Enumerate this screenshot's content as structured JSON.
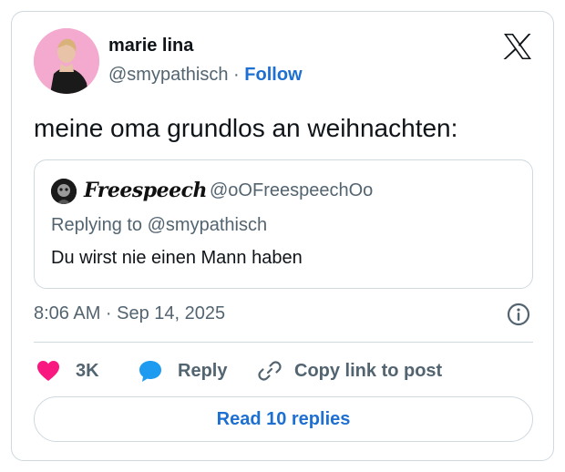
{
  "author": {
    "name": "marie lina",
    "handle": "@smypathisch",
    "separator": "·",
    "follow_label": "Follow"
  },
  "tweet": {
    "text": "meine oma grundlos an weihnachten:",
    "timestamp": "8:06 AM · Sep 14, 2025"
  },
  "quoted": {
    "name": "Freespeech",
    "handle": "@oOFreespeechOo",
    "replying_prefix": "Replying to",
    "replying_to": "@smypathisch",
    "text": "Du wirst nie einen Mann haben"
  },
  "actions": {
    "like_count": "3K",
    "reply_label": "Reply",
    "copy_label": "Copy link to post"
  },
  "read_replies_label": "Read 10 replies",
  "colors": {
    "link_blue": "#1d6fd1",
    "heart_pink": "#f91880",
    "reply_blue": "#1d9bf0",
    "muted_gray": "#536471",
    "border": "#cfd9de"
  },
  "icons": [
    "x-logo-icon",
    "info-icon",
    "heart-icon",
    "reply-bubble-icon",
    "link-icon"
  ]
}
